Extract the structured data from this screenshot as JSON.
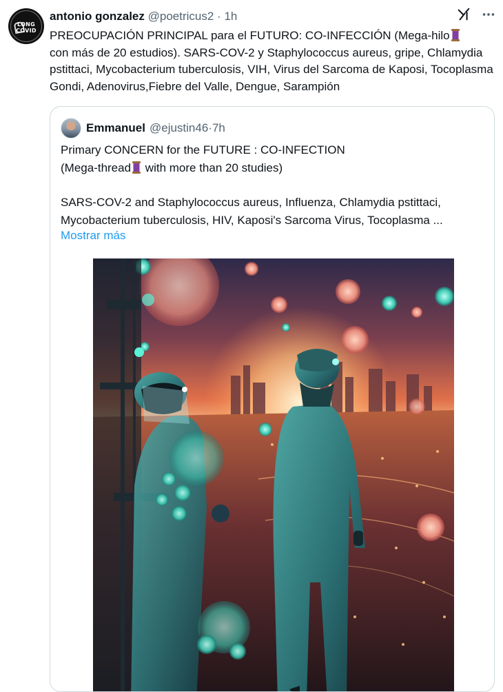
{
  "tweet": {
    "author_name": "antonio gonzalez",
    "handle": "@poetricus2",
    "separator": " · ",
    "time": "1h",
    "avatar_text": [
      "LONG",
      "COVID"
    ],
    "text_part1": "PREOCUPACIÓN PRINCIPAL para el FUTURO: CO-INFECCIÓN (Mega-hilo",
    "text_part2": "con más de 20 estudios). SARS-COV-2 y Staphylococcus aureus, gripe, Chlamydia pstittaci, Mycobacterium tuberculosis, VIH, Virus del Sarcoma de Kaposi, Tocoplasma Gondi, Adenovirus,Fiebre del Valle, Dengue, Sarampión",
    "icons": [
      "grok-icon",
      "more-icon"
    ]
  },
  "quote": {
    "author_name": "Emmanuel",
    "handle": "@ejustin46",
    "separator": " · ",
    "time": "7h",
    "line1": "Primary CONCERN for the FUTURE : CO-INFECTION",
    "line2_part1": "(Mega-thread",
    "line2_part2": " with more than 20 studies)",
    "line3": "SARS-COV-2 and Staphylococcus aureus, Influenza, Chlamydia pstittaci,",
    "line4": "Mycobacterium tuberculosis, HIV, Kaposi's Sarcoma Virus, Tocoplasma ...",
    "show_more": "Mostrar más"
  },
  "colors": {
    "link": "#1d9bf0",
    "muted": "#536471",
    "text": "#0f1419",
    "border": "#cfd9de"
  }
}
